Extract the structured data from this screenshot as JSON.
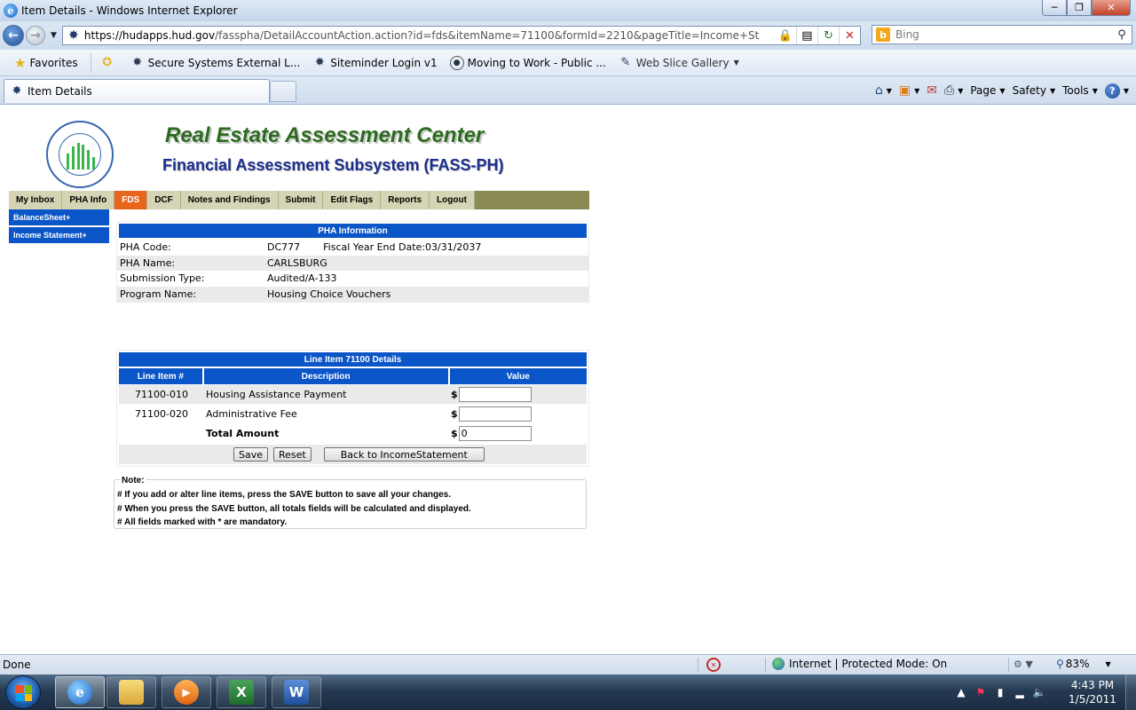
{
  "window": {
    "title": "Item Details - Windows Internet Explorer"
  },
  "address": {
    "url_host": "https://hudapps.hud.gov",
    "url_rest": "/fasspha/DetailAccountAction.action?id=fds&itemName=71100&formId=2210&pageTitle=Income+Statement&am",
    "search_placeholder": "Bing"
  },
  "favorites": {
    "label": "Favorites",
    "items": [
      {
        "label": "Secure Systems External L..."
      },
      {
        "label": "Siteminder Login v1"
      },
      {
        "label": "Moving to Work - Public ..."
      },
      {
        "label": "Web Slice Gallery"
      }
    ]
  },
  "tab": {
    "label": "Item Details"
  },
  "command_bar": {
    "page": "Page",
    "safety": "Safety",
    "tools": "Tools"
  },
  "site": {
    "title": "Real Estate Assessment Center",
    "subtitle": "Financial Assessment Subsystem (FASS-PH)"
  },
  "main_nav": [
    {
      "label": "My Inbox"
    },
    {
      "label": "PHA Info"
    },
    {
      "label": "FDS"
    },
    {
      "label": "DCF"
    },
    {
      "label": "Notes and Findings"
    },
    {
      "label": "Submit"
    },
    {
      "label": "Edit Flags"
    },
    {
      "label": "Reports"
    },
    {
      "label": "Logout"
    }
  ],
  "left_nav": [
    {
      "label": "BalanceSheet+"
    },
    {
      "label": "Income Statement+"
    }
  ],
  "pha_info": {
    "header": "PHA Information",
    "code_label": "PHA Code:",
    "code_value": "DC777",
    "fye_label": "Fiscal Year End Date:",
    "fye_value": "03/31/2037",
    "name_label": "PHA Name:",
    "name_value": "CARLSBURG",
    "submission_label": "Submission Type:",
    "submission_value": "Audited/A-133",
    "program_label": "Program Name:",
    "program_value": "Housing Choice Vouchers"
  },
  "line_items": {
    "header": "Line Item 71100 Details",
    "columns": [
      "Line Item #",
      "Description",
      "Value"
    ],
    "currency": "$",
    "rows": [
      {
        "code": "71100-010",
        "description": "Housing Assistance Payment",
        "value": ""
      },
      {
        "code": "71100-020",
        "description": "Administrative Fee",
        "value": ""
      }
    ],
    "total_label": "Total Amount",
    "total_value": "0",
    "buttons": {
      "save": "Save",
      "reset": "Reset",
      "back": "Back to IncomeStatement"
    }
  },
  "note": {
    "legend": "Note:",
    "lines": [
      "# If you add or alter line items, press the SAVE button to save all your changes.",
      "# When you press the SAVE button, all totals fields will be calculated and displayed.",
      "# All fields marked with * are mandatory."
    ]
  },
  "status": {
    "text": "Done",
    "zone": "Internet | Protected Mode: On",
    "zoom": "83%"
  },
  "taskbar": {
    "time": "4:43 PM",
    "date": "1/5/2011"
  }
}
